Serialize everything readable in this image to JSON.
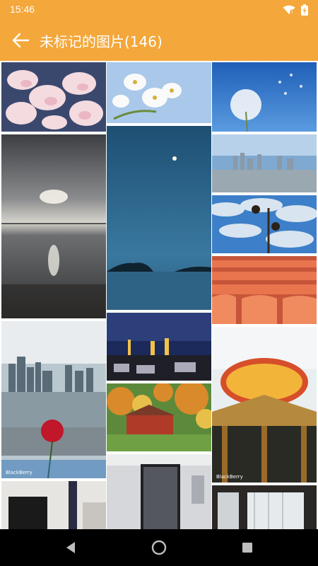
{
  "status": {
    "time": "15:46"
  },
  "header": {
    "title": "未标记的图片(146)",
    "back_icon": "back-arrow-icon"
  },
  "colors": {
    "accent": "#f4a73a",
    "navbar": "#000000"
  },
  "gallery": {
    "photos": [
      "magnolia-blossoms",
      "white-blossom-blue-sky",
      "dandelion-seeds",
      "sunset-over-sea",
      "moon-over-sea-dusk",
      "city-skyline-waterfront",
      "street-lamp-clouds",
      "orange-stadium-seats",
      "night-city-street",
      "skyline-with-red-flower",
      "autumn-red-barn",
      "restaurant-sign-gazebo",
      "room-tv-interior",
      "glass-door-interior",
      "building-glass-window"
    ],
    "watermark": "BlackBerry"
  },
  "navbar": {
    "icons": [
      "back-triangle-icon",
      "home-circle-icon",
      "recents-square-icon"
    ]
  }
}
